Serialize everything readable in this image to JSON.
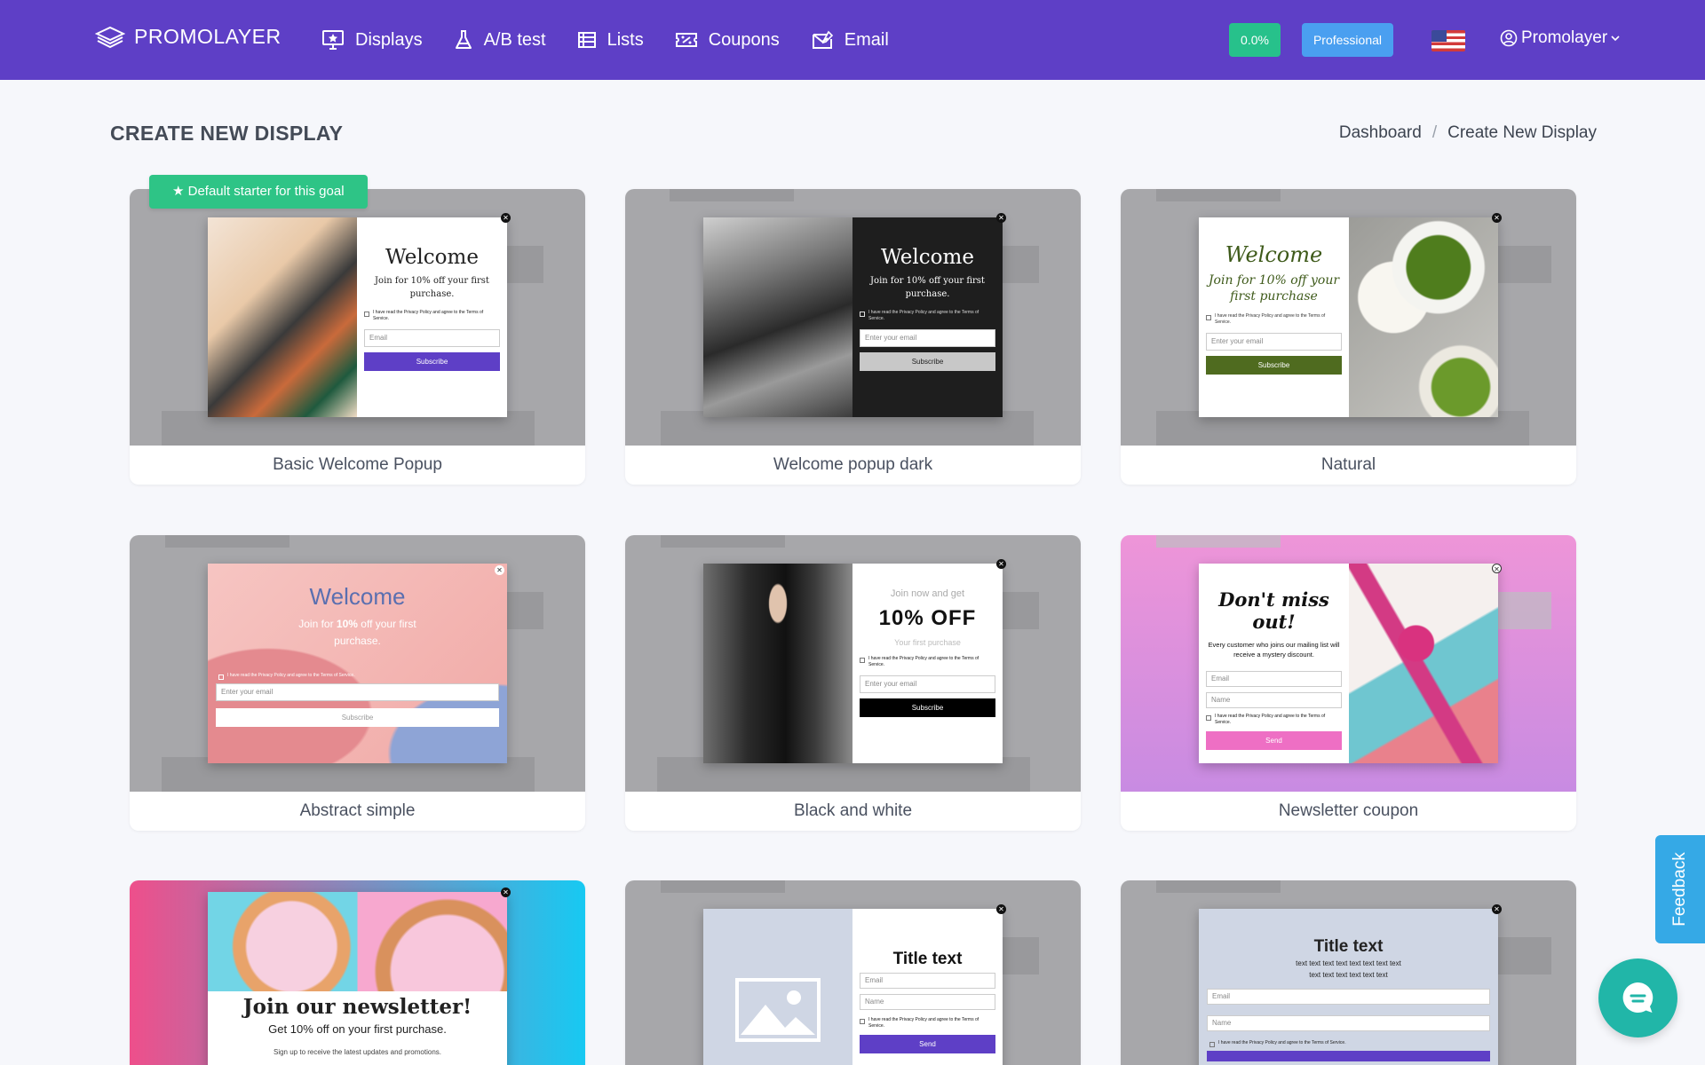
{
  "brand": {
    "name": "PROMOLAYER"
  },
  "nav": {
    "items": [
      {
        "label": "Displays",
        "icon": "monitor-star-icon"
      },
      {
        "label": "A/B test",
        "icon": "flask-icon"
      },
      {
        "label": "Lists",
        "icon": "list-icon"
      },
      {
        "label": "Coupons",
        "icon": "ticket-icon"
      },
      {
        "label": "Email",
        "icon": "envelope-icon"
      }
    ],
    "conversion_rate": "0.0%",
    "plan": "Professional",
    "language_flag": "us-flag-icon",
    "user": "Promolayer"
  },
  "page": {
    "title": "CREATE NEW DISPLAY",
    "breadcrumb": [
      "Dashboard",
      "Create New Display"
    ],
    "default_badge": "★ Default starter for this goal"
  },
  "templates": [
    {
      "name": "Basic Welcome Popup",
      "title": "Welcome",
      "subtitle": "Join for 10% off your first purchase.",
      "consent": "I have read the Privacy Policy and agree to the Terms of Service.",
      "input": "Email",
      "button": "Subscribe",
      "accent": "#5e3fc6"
    },
    {
      "name": "Welcome popup dark",
      "title": "Welcome",
      "subtitle": "Join for 10% off your first purchase.",
      "consent": "I have read the Privacy Policy and agree to the Terms of Service.",
      "input": "Enter your email",
      "button": "Subscribe",
      "accent": "#c8c8c8"
    },
    {
      "name": "Natural",
      "title": "Welcome",
      "subtitle": "Join for 10% off your first purchase",
      "consent": "I have read the Privacy Policy and agree to the Terms of Service.",
      "input": "Enter your email",
      "button": "Subscribe",
      "accent": "#4f6b1f"
    },
    {
      "name": "Abstract simple",
      "title": "Welcome",
      "subtitle_pre": "Join for ",
      "subtitle_bold": "10%",
      "subtitle_post": " off your first purchase.",
      "consent": "I have read the Privacy Policy and agree to the Terms of Service.",
      "input": "Enter your email",
      "button": "Subscribe"
    },
    {
      "name": "Black and white",
      "kicker": "Join now and get",
      "title": "10% OFF",
      "subtitle": "Your first purchase",
      "consent": "I have read the Privacy Policy and agree to the Terms of Service.",
      "input": "Enter your email",
      "button": "Subscribe"
    },
    {
      "name": "Newsletter coupon",
      "title": "Don't miss out!",
      "subtitle": "Every customer who joins our mailing list will receive a mystery discount.",
      "input_email": "Email",
      "input_name": "Name",
      "consent": "I have read the Privacy Policy and agree to the Terms of Service.",
      "button": "Send",
      "accent": "#ee6fc4"
    },
    {
      "name": "",
      "title": "Join our newsletter!",
      "subtitle": "Get 10% off on your first purchase.",
      "note": "Sign up to receive the latest updates and promotions."
    },
    {
      "name": "",
      "title": "Title text",
      "input_email": "Email",
      "input_name": "Name",
      "consent": "I have read the Privacy Policy and agree to the Terms of Service.",
      "button": "Send"
    },
    {
      "name": "",
      "title": "Title text",
      "body": "text text text text text text text text text text text text text text",
      "input_email": "Email",
      "input_name": "Name",
      "consent": "I have read the Privacy Policy and agree to the Terms of Service."
    }
  ],
  "feedback": "Feedback"
}
